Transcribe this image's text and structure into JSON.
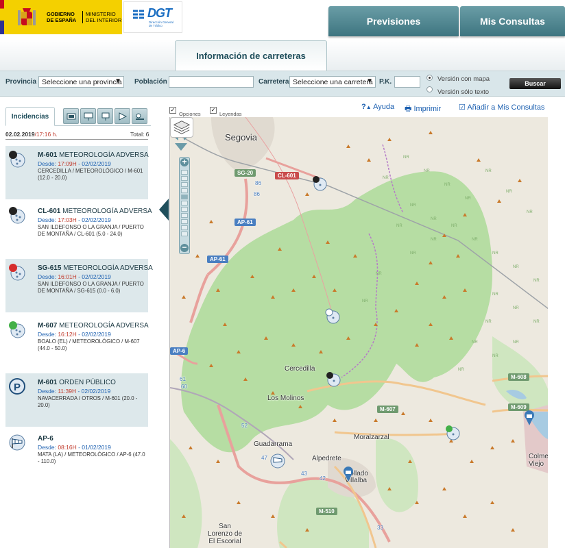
{
  "header": {
    "gob_line1": "GOBIERNO",
    "gob_line2": "DE ESPAÑA",
    "min_line1": "MINISTERIO",
    "min_line2": "DEL INTERIOR",
    "dgt_logo": "DGT",
    "dgt_sub1": "Dirección General",
    "dgt_sub2": "de Tráfico",
    "tabs": [
      "Previsiones",
      "Mis Consultas"
    ],
    "active_tab": "Información de carreteras"
  },
  "search": {
    "provincia_label": "Provincia",
    "provincia_value": "Seleccione una provincia",
    "poblacion_label": "Población",
    "poblacion_value": "",
    "carretera_label": "Carretera",
    "carretera_value": "Seleccione una carretera",
    "pk_label": "P.K.",
    "pk_value": "",
    "mode_map": "Versión con mapa",
    "mode_text": "Versión sólo texto",
    "selected_mode": "map",
    "search_button": "Buscar"
  },
  "panel": {
    "tab_label": "Incidencias",
    "tab_icons": [
      "camera-icon",
      "traffic-panel-icon",
      "sign-icon",
      "radar-icon",
      "weather-icon"
    ],
    "date": "02.02.2019",
    "time": "/17:16 h.",
    "total": "Total: 6",
    "incidents": [
      {
        "road": "M-601",
        "type": "METEOROLOGÍA ADVERSA",
        "desde": "Desde:",
        "hour": "17:09H",
        "date": "- 02/02/2019",
        "detail": "CERCEDILLA / METEOROLÓGICO / M-601 (12.0 - 20.0)",
        "icon": "weather-black-icon"
      },
      {
        "road": "CL-601",
        "type": "METEOROLOGÍA ADVERSA",
        "desde": "Desde:",
        "hour": "17:03H",
        "date": "- 02/02/2019",
        "detail": "SAN ILDEFONSO O LA GRANJA / PUERTO DE MONTAÑA / CL-601 (5.0 - 24.0)",
        "icon": "weather-black-icon"
      },
      {
        "road": "SG-615",
        "type": "METEOROLOGÍA ADVERSA",
        "desde": "Desde:",
        "hour": "16:01H",
        "date": "- 02/02/2019",
        "detail": "SAN ILDEFONSO O LA GRANJA / PUERTO DE MONTAÑA / SG-615 (0.0 - 6.0)",
        "icon": "weather-red-icon"
      },
      {
        "road": "M-607",
        "type": "METEOROLOGÍA ADVERSA",
        "desde": "Desde:",
        "hour": "16:12H",
        "date": "- 02/02/2019",
        "detail": "BOALO (EL) / METEOROLÓGICO / M-607 (44.0 - 50.0)",
        "icon": "weather-green-icon"
      },
      {
        "road": "M-601",
        "type": "ORDEN PÚBLICO",
        "desde": "Desde:",
        "hour": "11:39H",
        "date": "- 02/02/2019",
        "detail": "NAVACERRADA / OTROS / M-601 (20.0 - 20.0)",
        "icon": "parking-icon"
      },
      {
        "road": "AP-6",
        "type": "",
        "desde": "Desde:",
        "hour": "08:16H",
        "date": "- 01/02/2019",
        "detail": "MATA (LA) / METEOROLÓGICO / AP-6 (47.0 - 110.0)",
        "icon": "windsock-icon"
      }
    ]
  },
  "map_tools": {
    "opciones": "Opciones",
    "leyendas": "Leyendas",
    "ayuda": "Ayuda",
    "imprimir": "Imprimir",
    "anadir": "Añadir a Mis Consultas"
  },
  "map": {
    "places": [
      "Segovia",
      "Cercedilla",
      "Los Molinos",
      "Guadarrama",
      "Alpedrete",
      "Moralzarzal",
      "Collado Villalba",
      "San Lorenzo de El Escorial",
      "Colmenar Viejo"
    ],
    "roads": [
      "CL-601",
      "SG-20",
      "AP-61",
      "M-607",
      "M-608",
      "M-609",
      "M-510",
      "AP-6"
    ],
    "nr_label": "NR",
    "km_labels": [
      "86",
      "86",
      "61",
      "60",
      "52",
      "47",
      "43",
      "42",
      "33"
    ]
  },
  "colors": {
    "header_tab": "#3e7580",
    "panel_blue": "#1f4e5b",
    "hour_red": "#c0392b",
    "map_forest": "#b6dda3",
    "road_red": "#e8a19c"
  }
}
